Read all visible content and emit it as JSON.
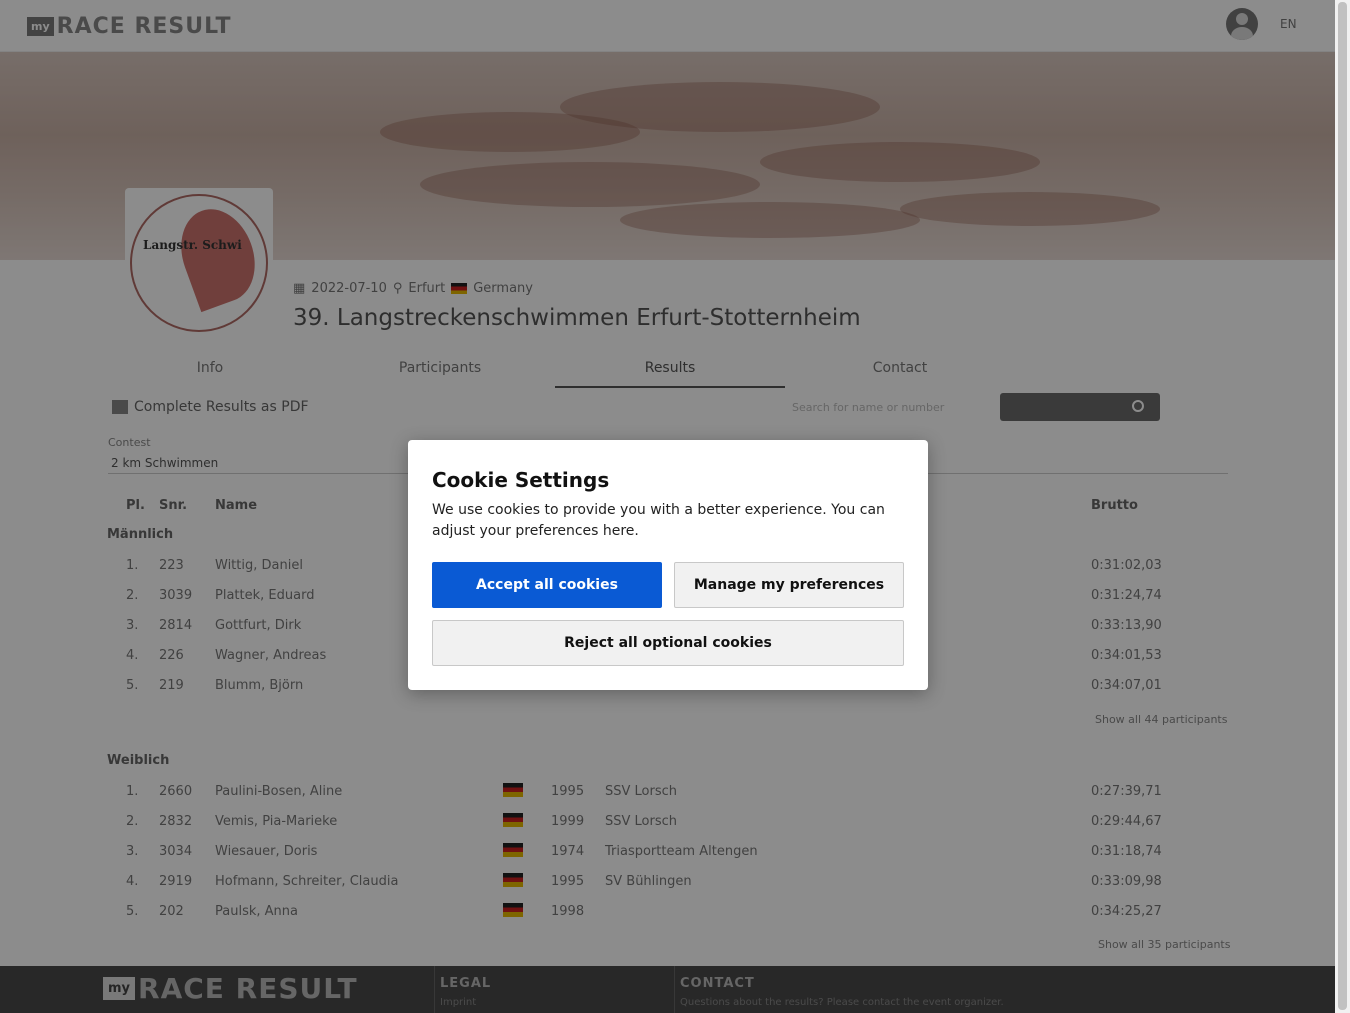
{
  "header": {
    "brand_badge": "my",
    "brand_word": "RACE RESULT",
    "lang": "EN"
  },
  "event": {
    "logo_text": "Langstr. Schwi",
    "date": "2022-07-10",
    "city": "Erfurt",
    "country": "Germany",
    "title": "39. Langstreckenschwimmen Erfurt-Stotternheim"
  },
  "tabs": [
    {
      "label": "Info"
    },
    {
      "label": "Participants"
    },
    {
      "label": "Results"
    },
    {
      "label": "Contact"
    }
  ],
  "results_toolbar": {
    "pdf_label": "Complete Results as PDF",
    "search_placeholder": "Search for name or number",
    "search_button": "Search"
  },
  "contest": {
    "label": "Contest",
    "value": "2 km Schwimmen"
  },
  "table": {
    "headers": {
      "place": "Pl.",
      "bib": "Snr.",
      "name": "Name",
      "time": "Brutto"
    },
    "groups": [
      {
        "title": "Männlich",
        "rows": [
          {
            "pl": "1.",
            "snr": "223",
            "name": "Wittig, Daniel",
            "yob": "",
            "club": "",
            "time": "0:31:02,03"
          },
          {
            "pl": "2.",
            "snr": "3039",
            "name": "Plattek, Eduard",
            "yob": "",
            "club": "",
            "time": "0:31:24,74"
          },
          {
            "pl": "3.",
            "snr": "2814",
            "name": "Gottfurt, Dirk",
            "yob": "",
            "club": "",
            "time": "0:33:13,90"
          },
          {
            "pl": "4.",
            "snr": "226",
            "name": "Wagner, Andreas",
            "yob": "",
            "club": "",
            "time": "0:34:01,53"
          },
          {
            "pl": "5.",
            "snr": "219",
            "name": "Blumm, Björn",
            "yob": "",
            "club": "",
            "time": "0:34:07,01"
          }
        ],
        "more_link": "Show all 44 participants"
      },
      {
        "title": "Weiblich",
        "rows": [
          {
            "pl": "1.",
            "snr": "2660",
            "name": "Paulini-Bosen, Aline",
            "yob": "1995",
            "club": "SSV Lorsch",
            "time": "0:27:39,71"
          },
          {
            "pl": "2.",
            "snr": "2832",
            "name": "Vemis, Pia-Marieke",
            "yob": "1999",
            "club": "SSV Lorsch",
            "time": "0:29:44,67"
          },
          {
            "pl": "3.",
            "snr": "3034",
            "name": "Wiesauer, Doris",
            "yob": "1974",
            "club": "Triasportteam Altengen",
            "time": "0:31:18,74"
          },
          {
            "pl": "4.",
            "snr": "2919",
            "name": "Hofmann, Schreiter, Claudia",
            "yob": "1995",
            "club": "SV Bühlingen",
            "time": "0:33:09,98"
          },
          {
            "pl": "5.",
            "snr": "202",
            "name": "Paulsk, Anna",
            "yob": "1998",
            "club": "",
            "time": "0:34:25,27"
          }
        ],
        "more_link": "Show all 35 participants"
      }
    ]
  },
  "footer": {
    "brand_badge": "my",
    "brand_word": "RACE RESULT",
    "legal_title": "LEGAL",
    "legal_sub": "Imprint",
    "contact_title": "CONTACT",
    "contact_sub": "Questions about the results? Please contact the event organizer."
  },
  "cookie_modal": {
    "title": "Cookie Settings",
    "text": "We use cookies to provide you with a better experience. You can adjust your preferences here.",
    "accept": "Accept all cookies",
    "manage": "Manage my preferences",
    "reject": "Reject all optional cookies"
  }
}
